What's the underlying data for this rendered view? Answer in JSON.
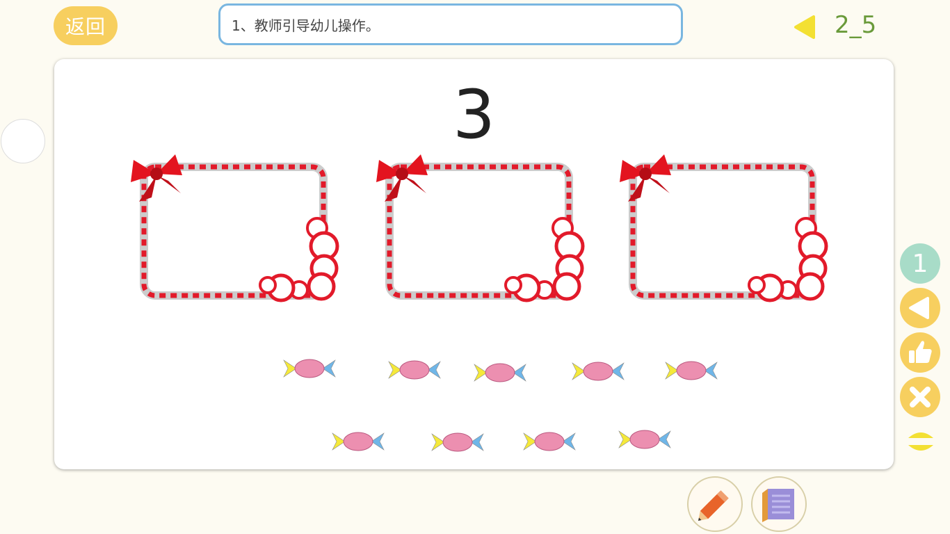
{
  "header": {
    "back_label": "返回",
    "instruction": "1、教师引导幼儿操作。",
    "page_indicator": "2_5"
  },
  "main": {
    "number": "3",
    "frames": [
      {},
      {},
      {}
    ],
    "candies_row1": 5,
    "candies_row2": 4
  },
  "side": {
    "step_number": "1",
    "buttons": [
      "back-arrow-icon",
      "thumbs-up-icon",
      "close-icon",
      "up-down-icon"
    ]
  },
  "tools": [
    "pencil-icon",
    "book-icon"
  ],
  "colors": {
    "accent_yellow": "#f7cf5f",
    "border_blue": "#79b6e0",
    "page_green": "#6a9a3a",
    "candy_pink": "#ec8fb0",
    "candy_yellow": "#f5e93a",
    "candy_blue": "#6fb6e8"
  }
}
